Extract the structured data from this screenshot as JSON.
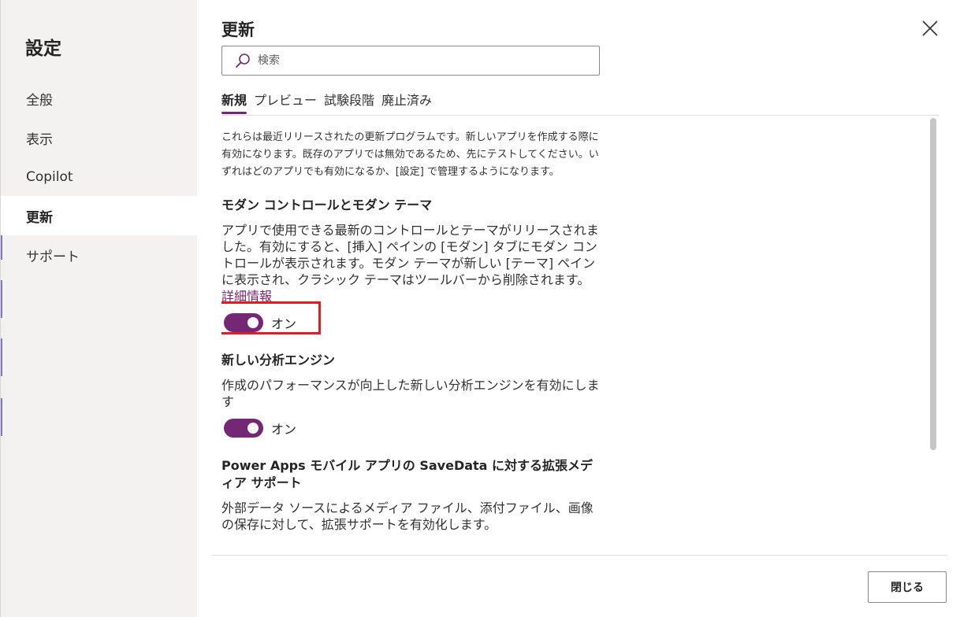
{
  "sidebar": {
    "title": "設定",
    "items": [
      {
        "label": "全般"
      },
      {
        "label": "表示"
      },
      {
        "label": "Copilot"
      },
      {
        "label": "更新"
      },
      {
        "label": "サポート"
      }
    ],
    "selected": "更新"
  },
  "panel": {
    "title": "更新",
    "search": {
      "placeholder": "検索",
      "value": ""
    },
    "tabs": [
      {
        "label": "新規"
      },
      {
        "label": "プレビュー"
      },
      {
        "label": "試験段階"
      },
      {
        "label": "廃止済み"
      }
    ],
    "active_tab": "新規",
    "intro": "これらは最近リリースされたの更新プログラムです。新しいアプリを作成する際に有効になります。既存のアプリでは無効であるため、先にテストしてください。いずれはどのアプリでも有効になるか、[設定] で管理するようになります。",
    "features": [
      {
        "title": "モダン コントロールとモダン テーマ",
        "description": "アプリで使用できる最新のコントロールとテーマがリリースされました。有効にすると、[挿入] ペインの [モダン] タブにモダン コントロールが表示されます。モダン テーマが新しい [テーマ] ペインに表示され、クラシック テーマはツールバーから削除されます。",
        "link": "詳細情報",
        "toggle_state": "オン",
        "toggle_on": true
      },
      {
        "title": "新しい分析エンジン",
        "description": "作成のパフォーマンスが向上した新しい分析エンジンを有効にします",
        "toggle_state": "オン",
        "toggle_on": true
      },
      {
        "title": "Power Apps モバイル アプリの SaveData に対する拡張メディア サポート",
        "description": "外部データ ソースによるメディア ファイル、添付ファイル、画像の保存に対して、拡張サポートを有効化します。"
      }
    ]
  },
  "footer": {
    "close_label": "閉じる"
  },
  "colors": {
    "accent": "#742774",
    "sidebar_bg": "#f3f2f1",
    "highlight": "#e41b23"
  },
  "icons": {
    "close": "close-icon",
    "search": "search-icon"
  }
}
